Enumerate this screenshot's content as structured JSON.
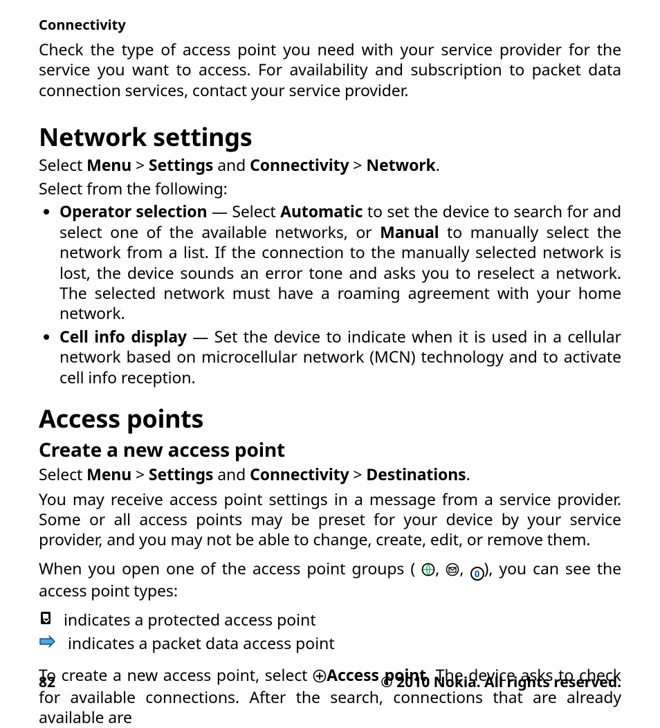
{
  "section_label": "Connectivity",
  "intro_para": "Check the type of access point you need with your service provider for the service you want to access. For availability and subscription to packet data connection services, contact your service provider.",
  "network": {
    "heading": "Network settings",
    "path": {
      "select_word": "Select ",
      "menu": "Menu",
      "gt1": "  >  ",
      "settings": "Settings",
      "and": " and ",
      "connectivity": "Connectivity",
      "gt2": "  >  ",
      "network": "Network",
      "period": "."
    },
    "select_following": "Select from the following:",
    "items": {
      "op_sel": {
        "title": "Operator selection",
        "dash_pre": "  — Select ",
        "auto": "Automatic",
        "seg1": " to set the device to search for and select one of the available networks, or ",
        "manual": "Manual",
        "seg2": " to manually select the network from a list. If the connection to the manually selected network is lost, the device sounds an error tone and asks you to reselect a network. The selected network must have a roaming agreement with your home network."
      },
      "cell_info": {
        "title": "Cell info display",
        "rest": "  — Set the device to indicate when it is used in a cellular network based on microcellular network (MCN) technology and to activate cell info reception."
      }
    }
  },
  "access_points": {
    "heading": "Access points",
    "subheading": "Create a new access point",
    "path": {
      "select_word": "Select ",
      "menu": "Menu",
      "gt1": "  >  ",
      "settings": "Settings",
      "and": " and ",
      "connectivity": "Connectivity",
      "gt2": "  >  ",
      "destinations": "Destinations",
      "period": "."
    },
    "para1": "You may receive access point settings in a message from a service provider. Some or all access points may be preset for your device by your service provider, and you may not be able to change, create, edit, or remove them.",
    "groups_pre": "When you open one of the access point groups (",
    "groups_post": "), you can see the access point types:",
    "protected_text": "indicates a protected access point",
    "packet_text": "indicates a packet data access point",
    "create": {
      "pre": "To create a new access point, select ",
      "ap": "Access point",
      "post": ". The device asks to check for available connections. After the search, connections that are already available are"
    }
  },
  "footer": {
    "page": "82",
    "copyright": "© 2010 Nokia. All rights reserved."
  },
  "icons": {
    "globe": "globe-icon",
    "mms": "mms-icon",
    "operator": "operator-icon",
    "protected": "protected-icon",
    "packet": "packet-data-icon",
    "add": "add-access-point-icon",
    "operator_glyph": "0"
  }
}
